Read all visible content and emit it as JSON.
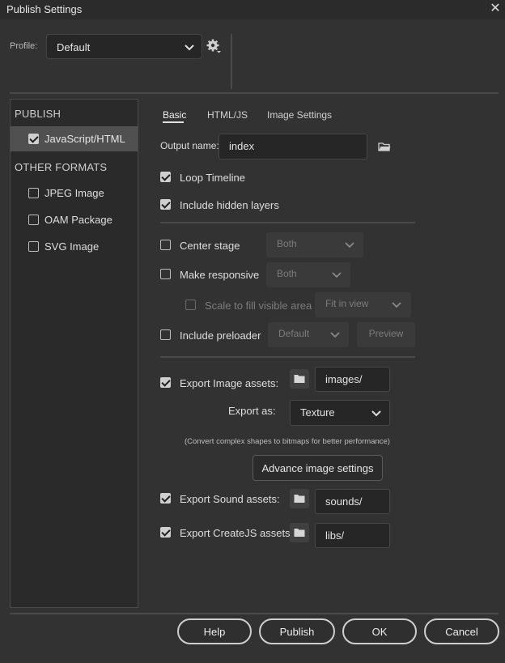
{
  "window": {
    "title": "Publish Settings",
    "close_glyph": "✕"
  },
  "profile": {
    "label": "Profile:",
    "value": "Default",
    "settings_icon": "gear-icon"
  },
  "left_panel": {
    "publish_header": "PUBLISH",
    "publish_items": [
      {
        "label": "JavaScript/HTML",
        "checked": true,
        "selected": true
      }
    ],
    "other_header": "OTHER FORMATS",
    "other_items": [
      {
        "label": "JPEG Image",
        "checked": false
      },
      {
        "label": "OAM Package",
        "checked": false
      },
      {
        "label": "SVG Image",
        "checked": false
      }
    ]
  },
  "tabs": [
    {
      "label": "Basic",
      "active": true
    },
    {
      "label": "HTML/JS",
      "active": false
    },
    {
      "label": "Image Settings",
      "active": false
    }
  ],
  "basic": {
    "output_name_label": "Output name:",
    "output_name_value": "index",
    "loop_timeline": {
      "label": "Loop Timeline",
      "checked": true
    },
    "include_hidden_layers": {
      "label": "Include hidden layers",
      "checked": true
    },
    "center_stage": {
      "label": "Center stage",
      "checked": false,
      "option": "Both"
    },
    "make_responsive": {
      "label": "Make responsive",
      "checked": false,
      "option": "Both"
    },
    "scale_to_fill": {
      "label": "Scale to fill visible area",
      "checked": false,
      "option": "Fit in view"
    },
    "include_preloader": {
      "label": "Include preloader",
      "checked": false,
      "option": "Default",
      "preview_label": "Preview"
    },
    "export_image_assets": {
      "label": "Export Image assets:",
      "checked": true,
      "path": "images/"
    },
    "export_as": {
      "label": "Export as:",
      "value": "Texture"
    },
    "note": "(Convert complex shapes to bitmaps for better performance)",
    "advance_image_settings": "Advance image settings",
    "export_sound_assets": {
      "label": "Export Sound assets:",
      "checked": true,
      "path": "sounds/"
    },
    "export_createjs_assets": {
      "label": "Export CreateJS assets:",
      "checked": true,
      "path": "libs/"
    }
  },
  "footer": {
    "help": "Help",
    "publish": "Publish",
    "ok": "OK",
    "cancel": "Cancel"
  }
}
